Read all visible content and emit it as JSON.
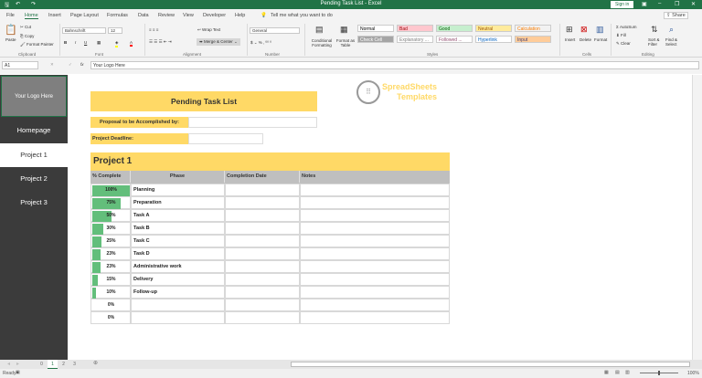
{
  "window": {
    "title": "Pending Task List - Excel",
    "sign_in": "Sign in",
    "share": "Share"
  },
  "menu": [
    "File",
    "Home",
    "Insert",
    "Page Layout",
    "Formulas",
    "Data",
    "Review",
    "View",
    "Developer",
    "Help"
  ],
  "tell_me": "Tell me what you want to do",
  "ribbon": {
    "clipboard": {
      "paste": "Paste",
      "cut": "Cut",
      "copy": "Copy",
      "format_painter": "Format Painter",
      "label": "Clipboard"
    },
    "font": {
      "name": "Bahnschrift",
      "size": "12",
      "label": "Font"
    },
    "alignment": {
      "wrap": "Wrap Text",
      "merge": "Merge & Center",
      "label": "Alignment"
    },
    "number": {
      "format": "General",
      "label": "Number"
    },
    "styles": {
      "conditional": "Conditional Formatting",
      "format_table": "Format as Table",
      "label": "Styles",
      "cells": [
        {
          "t": "Normal",
          "bg": "#ffffff",
          "c": "#000"
        },
        {
          "t": "Bad",
          "bg": "#ffc7ce",
          "c": "#9c0006"
        },
        {
          "t": "Good",
          "bg": "#c6efce",
          "c": "#006100"
        },
        {
          "t": "Neutral",
          "bg": "#ffeb9c",
          "c": "#9c5700"
        },
        {
          "t": "Calculation",
          "bg": "#f2f2f2",
          "c": "#fa7d00"
        },
        {
          "t": "Check Cell",
          "bg": "#a5a5a5",
          "c": "#fff"
        },
        {
          "t": "Explanatory ...",
          "bg": "#fff",
          "c": "#7f7f7f"
        },
        {
          "t": "Followed ...",
          "bg": "#fff",
          "c": "#954f72"
        },
        {
          "t": "Hyperlink",
          "bg": "#fff",
          "c": "#0563c1"
        },
        {
          "t": "Input",
          "bg": "#ffcc99",
          "c": "#3f3f76"
        }
      ]
    },
    "cells": {
      "insert": "Insert",
      "delete": "Delete",
      "format": "Format",
      "label": "Cells"
    },
    "editing": {
      "autosum": "AutoSum",
      "fill": "Fill",
      "clear": "Clear",
      "sort": "Sort & Filter",
      "find": "Find & Select",
      "label": "Editing"
    }
  },
  "formula_bar": {
    "name_box": "A1",
    "content": "Your Logo Here"
  },
  "sidebar": {
    "logo": "Your Logo Here",
    "items": [
      "Homepage",
      "Project 1",
      "Project 2",
      "Project 3"
    ],
    "selected": 1
  },
  "sheet": {
    "title": "Pending Task List",
    "proposal_label": "Proposal to be Accomplished by:",
    "deadline_label": "Project Deadline:",
    "brand": [
      "SpreadSheets",
      "Templates"
    ],
    "project": "Project 1",
    "headers": [
      "% Complete",
      "Phase",
      "Completion Date",
      "Notes"
    ],
    "rows": [
      {
        "pct": 100,
        "label": "100%",
        "phase": "Planning"
      },
      {
        "pct": 75,
        "label": "75%",
        "phase": "Preparation"
      },
      {
        "pct": 50,
        "label": "50%",
        "phase": "Task A"
      },
      {
        "pct": 30,
        "label": "30%",
        "phase": "Task B"
      },
      {
        "pct": 25,
        "label": "25%",
        "phase": "Task C"
      },
      {
        "pct": 23,
        "label": "23%",
        "phase": "Task D"
      },
      {
        "pct": 23,
        "label": "23%",
        "phase": "Administrative work"
      },
      {
        "pct": 15,
        "label": "15%",
        "phase": "Delivery"
      },
      {
        "pct": 10,
        "label": "10%",
        "phase": "Follow-up"
      },
      {
        "pct": 0,
        "label": "0%",
        "phase": ""
      },
      {
        "pct": 0,
        "label": "0%",
        "phase": ""
      }
    ]
  },
  "sheet_tabs": [
    "0",
    "1",
    "2",
    "3"
  ],
  "active_tab": "1",
  "status": {
    "ready": "Ready",
    "zoom": "100%"
  }
}
